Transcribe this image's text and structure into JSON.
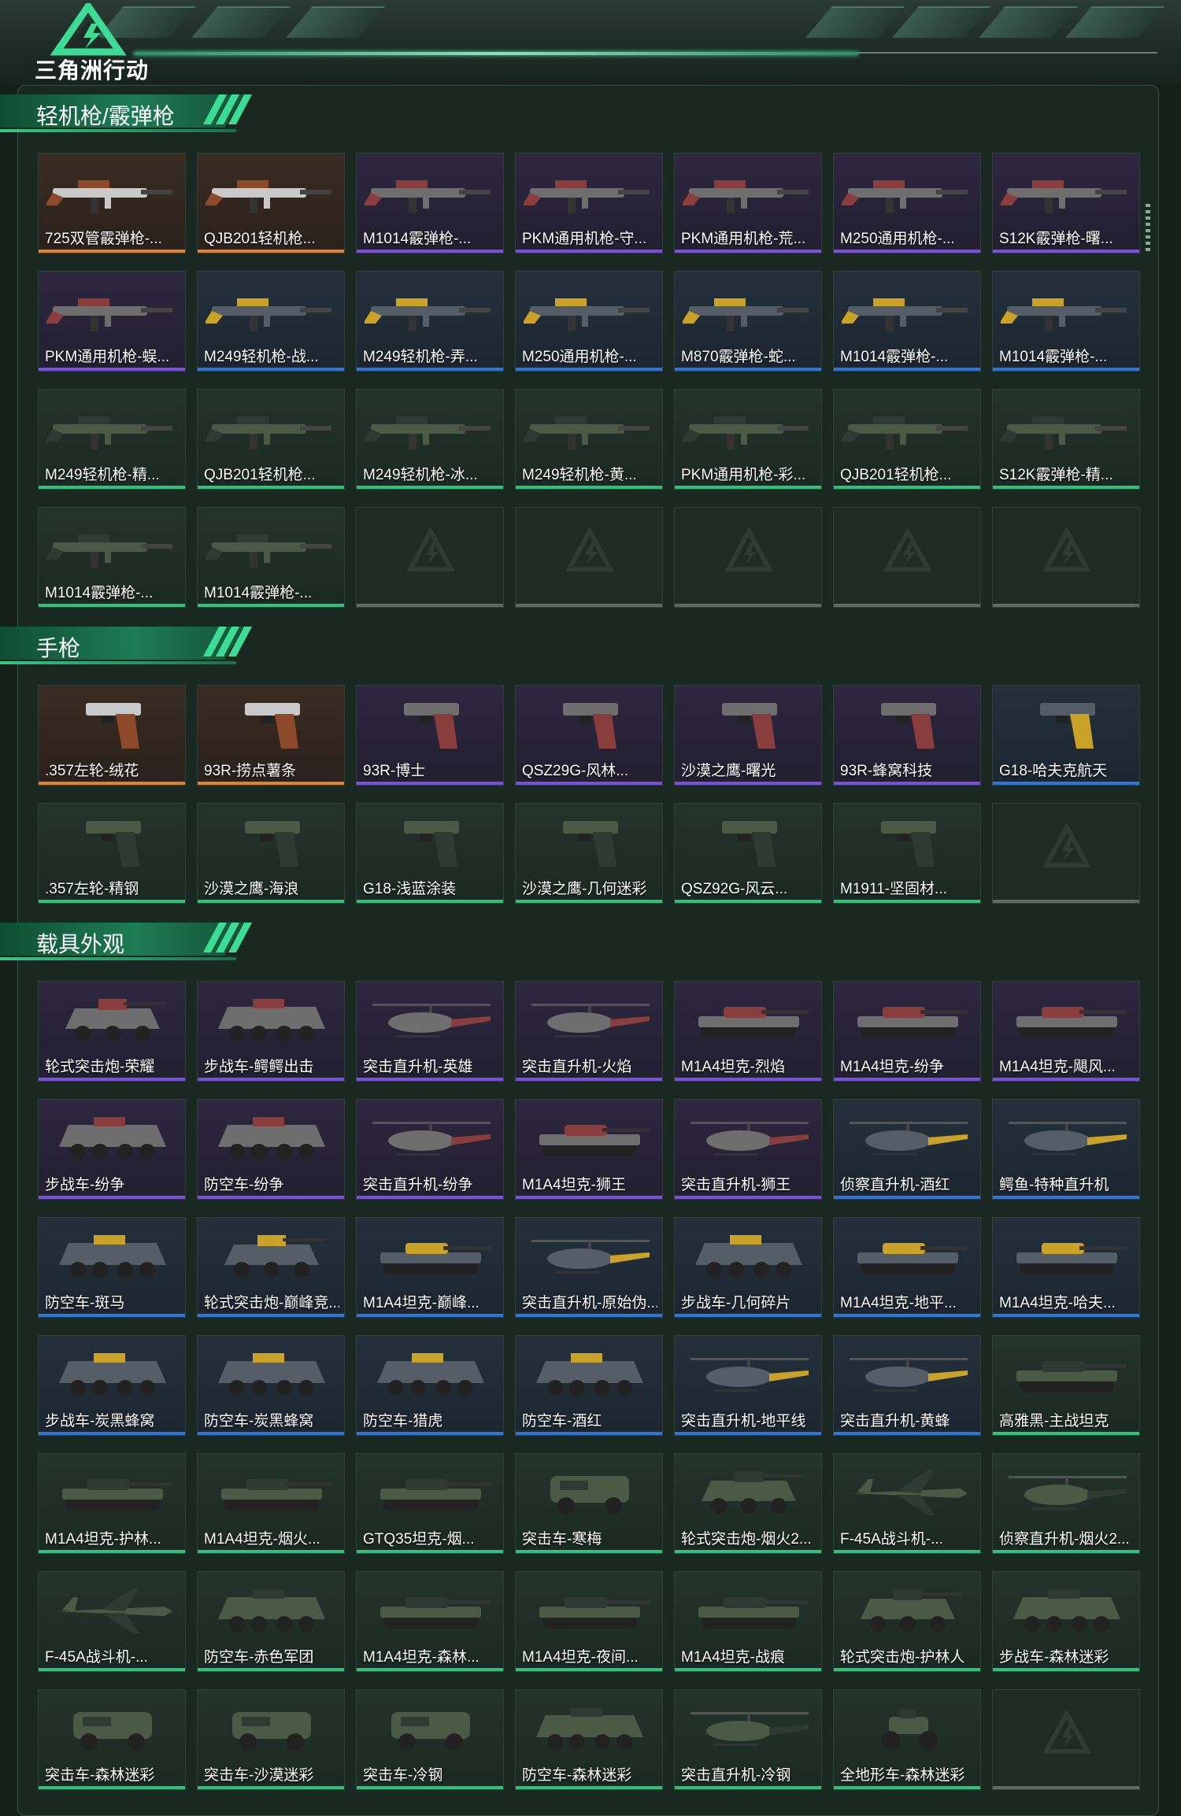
{
  "header": {
    "logo_text": "三角洲行动",
    "logo_icon": "delta-triangle-logo"
  },
  "colors": {
    "orange": "#e0822e",
    "purple": "#7b4ee0",
    "blue": "#2f74d8",
    "green": "#2fc27a",
    "accent": "#31c986"
  },
  "sections": [
    {
      "title": "轻机枪/霰弹枪",
      "items": [
        {
          "label": "725双管霰弹枪-...",
          "rarity": "orange",
          "type": "gun"
        },
        {
          "label": "QJB201轻机枪...",
          "rarity": "orange",
          "type": "gun"
        },
        {
          "label": "M1014霰弹枪-...",
          "rarity": "purple",
          "type": "gun"
        },
        {
          "label": "PKM通用机枪-守...",
          "rarity": "purple",
          "type": "gun"
        },
        {
          "label": "PKM通用机枪-荒...",
          "rarity": "purple",
          "type": "gun"
        },
        {
          "label": "M250通用机枪-...",
          "rarity": "purple",
          "type": "gun"
        },
        {
          "label": "S12K霰弹枪-曙...",
          "rarity": "purple",
          "type": "gun"
        },
        {
          "label": "PKM通用机枪-蜈...",
          "rarity": "purple",
          "type": "gun"
        },
        {
          "label": "M249轻机枪-战...",
          "rarity": "blue",
          "type": "gun"
        },
        {
          "label": "M249轻机枪-弄...",
          "rarity": "blue",
          "type": "gun"
        },
        {
          "label": "M250通用机枪-...",
          "rarity": "blue",
          "type": "gun"
        },
        {
          "label": "M870霰弹枪-蛇...",
          "rarity": "blue",
          "type": "gun"
        },
        {
          "label": "M1014霰弹枪-...",
          "rarity": "blue",
          "type": "gun"
        },
        {
          "label": "M1014霰弹枪-...",
          "rarity": "blue",
          "type": "gun"
        },
        {
          "label": "M249轻机枪-精...",
          "rarity": "green",
          "type": "gun"
        },
        {
          "label": "QJB201轻机枪...",
          "rarity": "green",
          "type": "gun"
        },
        {
          "label": "M249轻机枪-冰...",
          "rarity": "green",
          "type": "gun"
        },
        {
          "label": "M249轻机枪-黄...",
          "rarity": "green",
          "type": "gun"
        },
        {
          "label": "PKM通用机枪-彩...",
          "rarity": "green",
          "type": "gun"
        },
        {
          "label": "QJB201轻机枪...",
          "rarity": "green",
          "type": "gun"
        },
        {
          "label": "S12K霰弹枪-精...",
          "rarity": "green",
          "type": "gun"
        },
        {
          "label": "M1014霰弹枪-...",
          "rarity": "green",
          "type": "gun"
        },
        {
          "label": "M1014霰弹枪-...",
          "rarity": "green",
          "type": "gun"
        },
        {
          "label": "",
          "rarity": "empty",
          "type": "empty"
        },
        {
          "label": "",
          "rarity": "empty",
          "type": "empty"
        },
        {
          "label": "",
          "rarity": "empty",
          "type": "empty"
        },
        {
          "label": "",
          "rarity": "empty",
          "type": "empty"
        },
        {
          "label": "",
          "rarity": "empty",
          "type": "empty"
        }
      ]
    },
    {
      "title": "手枪",
      "items": [
        {
          "label": ".357左轮-绒花",
          "rarity": "orange",
          "type": "pistol"
        },
        {
          "label": "93R-捞点薯条",
          "rarity": "orange",
          "type": "pistol"
        },
        {
          "label": "93R-博士",
          "rarity": "purple",
          "type": "pistol"
        },
        {
          "label": "QSZ29G-风林...",
          "rarity": "purple",
          "type": "pistol"
        },
        {
          "label": "沙漠之鹰-曙光",
          "rarity": "purple",
          "type": "pistol"
        },
        {
          "label": "93R-蜂窝科技",
          "rarity": "purple",
          "type": "pistol"
        },
        {
          "label": "G18-哈夫克航天",
          "rarity": "blue",
          "type": "pistol"
        },
        {
          "label": ".357左轮-精钢",
          "rarity": "green",
          "type": "pistol"
        },
        {
          "label": "沙漠之鹰-海浪",
          "rarity": "green",
          "type": "pistol"
        },
        {
          "label": "G18-浅蓝涂装",
          "rarity": "green",
          "type": "pistol"
        },
        {
          "label": "沙漠之鹰-几何迷彩",
          "rarity": "green",
          "type": "pistol"
        },
        {
          "label": "QSZ92G-风云...",
          "rarity": "green",
          "type": "pistol"
        },
        {
          "label": "M1911-坚固材...",
          "rarity": "green",
          "type": "pistol"
        },
        {
          "label": "",
          "rarity": "empty",
          "type": "empty"
        }
      ]
    },
    {
      "title": "载具外观",
      "items": [
        {
          "label": "轮式突击炮-荣耀",
          "rarity": "purple",
          "type": "wheeled"
        },
        {
          "label": "步战车-鳄鳄出击",
          "rarity": "purple",
          "type": "apc"
        },
        {
          "label": "突击直升机-英雄",
          "rarity": "purple",
          "type": "heli"
        },
        {
          "label": "突击直升机-火焰",
          "rarity": "purple",
          "type": "heli"
        },
        {
          "label": "M1A4坦克-烈焰",
          "rarity": "purple",
          "type": "tank"
        },
        {
          "label": "M1A4坦克-纷争",
          "rarity": "purple",
          "type": "tank"
        },
        {
          "label": "M1A4坦克-飓风...",
          "rarity": "purple",
          "type": "tank"
        },
        {
          "label": "步战车-纷争",
          "rarity": "purple",
          "type": "apc"
        },
        {
          "label": "防空车-纷争",
          "rarity": "purple",
          "type": "apc"
        },
        {
          "label": "突击直升机-纷争",
          "rarity": "purple",
          "type": "heli"
        },
        {
          "label": "M1A4坦克-狮王",
          "rarity": "purple",
          "type": "tank"
        },
        {
          "label": "突击直升机-狮王",
          "rarity": "purple",
          "type": "heli"
        },
        {
          "label": "侦察直升机-酒红",
          "rarity": "blue",
          "type": "heli"
        },
        {
          "label": "鳄鱼-特种直升机",
          "rarity": "blue",
          "type": "heli"
        },
        {
          "label": "防空车-斑马",
          "rarity": "blue",
          "type": "apc"
        },
        {
          "label": "轮式突击炮-巅峰竞...",
          "rarity": "blue",
          "type": "wheeled"
        },
        {
          "label": "M1A4坦克-巅峰...",
          "rarity": "blue",
          "type": "tank"
        },
        {
          "label": "突击直升机-原始伪...",
          "rarity": "blue",
          "type": "heli"
        },
        {
          "label": "步战车-几何碎片",
          "rarity": "blue",
          "type": "apc"
        },
        {
          "label": "M1A4坦克-地平...",
          "rarity": "blue",
          "type": "tank"
        },
        {
          "label": "M1A4坦克-哈夫...",
          "rarity": "blue",
          "type": "tank"
        },
        {
          "label": "步战车-炭黑蜂窝",
          "rarity": "blue",
          "type": "apc"
        },
        {
          "label": "防空车-炭黑蜂窝",
          "rarity": "blue",
          "type": "apc"
        },
        {
          "label": "防空车-猎虎",
          "rarity": "blue",
          "type": "apc"
        },
        {
          "label": "防空车-酒红",
          "rarity": "blue",
          "type": "apc"
        },
        {
          "label": "突击直升机-地平线",
          "rarity": "blue",
          "type": "heli"
        },
        {
          "label": "突击直升机-黄蜂",
          "rarity": "blue",
          "type": "heli"
        },
        {
          "label": "高雅黑-主战坦克",
          "rarity": "green",
          "type": "tank"
        },
        {
          "label": "M1A4坦克-护林...",
          "rarity": "green",
          "type": "tank"
        },
        {
          "label": "M1A4坦克-烟火...",
          "rarity": "green",
          "type": "tank"
        },
        {
          "label": "GTQ35坦克-烟...",
          "rarity": "green",
          "type": "tank"
        },
        {
          "label": "突击车-寒梅",
          "rarity": "green",
          "type": "car"
        },
        {
          "label": "轮式突击炮-烟火2...",
          "rarity": "green",
          "type": "wheeled"
        },
        {
          "label": "F-45A战斗机-...",
          "rarity": "green",
          "type": "jet"
        },
        {
          "label": "侦察直升机-烟火2...",
          "rarity": "green",
          "type": "heli"
        },
        {
          "label": "F-45A战斗机-...",
          "rarity": "green",
          "type": "jet"
        },
        {
          "label": "防空车-赤色军团",
          "rarity": "green",
          "type": "apc"
        },
        {
          "label": "M1A4坦克-森林...",
          "rarity": "green",
          "type": "tank"
        },
        {
          "label": "M1A4坦克-夜间...",
          "rarity": "green",
          "type": "tank"
        },
        {
          "label": "M1A4坦克-战痕",
          "rarity": "green",
          "type": "tank"
        },
        {
          "label": "轮式突击炮-护林人",
          "rarity": "green",
          "type": "wheeled"
        },
        {
          "label": "步战车-森林迷彩",
          "rarity": "green",
          "type": "apc"
        },
        {
          "label": "突击车-森林迷彩",
          "rarity": "green",
          "type": "car"
        },
        {
          "label": "突击车-沙漠迷彩",
          "rarity": "green",
          "type": "car"
        },
        {
          "label": "突击车-冷钢",
          "rarity": "green",
          "type": "car"
        },
        {
          "label": "防空车-森林迷彩",
          "rarity": "green",
          "type": "apc"
        },
        {
          "label": "突击直升机-冷钢",
          "rarity": "green",
          "type": "heli"
        },
        {
          "label": "全地形车-森林迷彩",
          "rarity": "green",
          "type": "atv"
        },
        {
          "label": "",
          "rarity": "empty",
          "type": "empty"
        }
      ]
    }
  ]
}
